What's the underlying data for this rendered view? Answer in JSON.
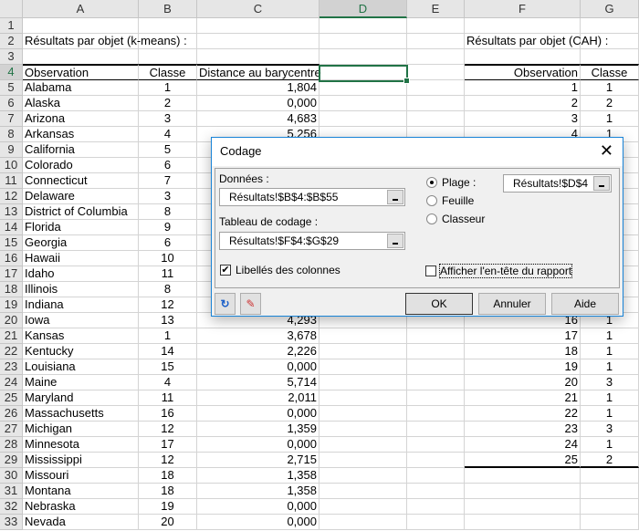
{
  "columns": [
    "A",
    "B",
    "C",
    "D",
    "E",
    "F",
    "G"
  ],
  "selected_column": "D",
  "selected_row": 4,
  "cells": {
    "2": {
      "A": "Résultats par objet (k-means) :",
      "F": "Résultats par objet (CAH) :"
    },
    "4": {
      "A": "Observation",
      "B": "Classe",
      "C": "Distance au barycentre",
      "F": "Observation",
      "G": "Classe"
    },
    "5": {
      "A": "Alabama",
      "B": "1",
      "C": "1,804",
      "F": "1",
      "G": "1"
    },
    "6": {
      "A": "Alaska",
      "B": "2",
      "C": "0,000",
      "F": "2",
      "G": "2"
    },
    "7": {
      "A": "Arizona",
      "B": "3",
      "C": "4,683",
      "F": "3",
      "G": "1"
    },
    "8": {
      "A": "Arkansas",
      "B": "4",
      "C": "5,256",
      "F": "4",
      "G": "1"
    },
    "9": {
      "A": "California",
      "B": "5"
    },
    "10": {
      "A": "Colorado",
      "B": "6"
    },
    "11": {
      "A": "Connecticut",
      "B": "7"
    },
    "12": {
      "A": "Delaware",
      "B": "3"
    },
    "13": {
      "A": "District of Columbia",
      "B": "8"
    },
    "14": {
      "A": "Florida",
      "B": "9"
    },
    "15": {
      "A": "Georgia",
      "B": "6"
    },
    "16": {
      "A": "Hawaii",
      "B": "10"
    },
    "17": {
      "A": "Idaho",
      "B": "11"
    },
    "18": {
      "A": "Illinois",
      "B": "8"
    },
    "19": {
      "A": "Indiana",
      "B": "12"
    },
    "20": {
      "A": "Iowa",
      "B": "13",
      "C": "4,293",
      "F": "16",
      "G": "1"
    },
    "21": {
      "A": "Kansas",
      "B": "1",
      "C": "3,678",
      "F": "17",
      "G": "1"
    },
    "22": {
      "A": "Kentucky",
      "B": "14",
      "C": "2,226",
      "F": "18",
      "G": "1"
    },
    "23": {
      "A": "Louisiana",
      "B": "15",
      "C": "0,000",
      "F": "19",
      "G": "1"
    },
    "24": {
      "A": "Maine",
      "B": "4",
      "C": "5,714",
      "F": "20",
      "G": "3"
    },
    "25": {
      "A": "Maryland",
      "B": "11",
      "C": "2,011",
      "F": "21",
      "G": "1"
    },
    "26": {
      "A": "Massachusetts",
      "B": "16",
      "C": "0,000",
      "F": "22",
      "G": "1"
    },
    "27": {
      "A": "Michigan",
      "B": "12",
      "C": "1,359",
      "F": "23",
      "G": "3"
    },
    "28": {
      "A": "Minnesota",
      "B": "17",
      "C": "0,000",
      "F": "24",
      "G": "1"
    },
    "29": {
      "A": "Mississippi",
      "B": "12",
      "C": "2,715",
      "F": "25",
      "G": "2"
    },
    "30": {
      "A": "Missouri",
      "B": "18",
      "C": "1,358"
    },
    "31": {
      "A": "Montana",
      "B": "18",
      "C": "1,358"
    },
    "32": {
      "A": "Nebraska",
      "B": "19",
      "C": "0,000"
    },
    "33": {
      "A": "Nevada",
      "B": "20",
      "C": "0,000"
    }
  },
  "dialog": {
    "title": "Codage",
    "close": "✕",
    "donnees_label": "Données :",
    "donnees_value": "Résultats!$B$4:$B$55",
    "tableau_label": "Tableau de codage :",
    "tableau_value": "Résultats!$F$4:$G$29",
    "plage_label": "Plage :",
    "plage_value": "Résultats!$D$4",
    "feuille_label": "Feuille",
    "classeur_label": "Classeur",
    "libelles_label": "Libellés des colonnes",
    "libelles_checked": true,
    "afficher_label": "Afficher l'en-tête du rapport",
    "afficher_checked": false,
    "ok": "OK",
    "annuler": "Annuler",
    "aide": "Aide"
  }
}
